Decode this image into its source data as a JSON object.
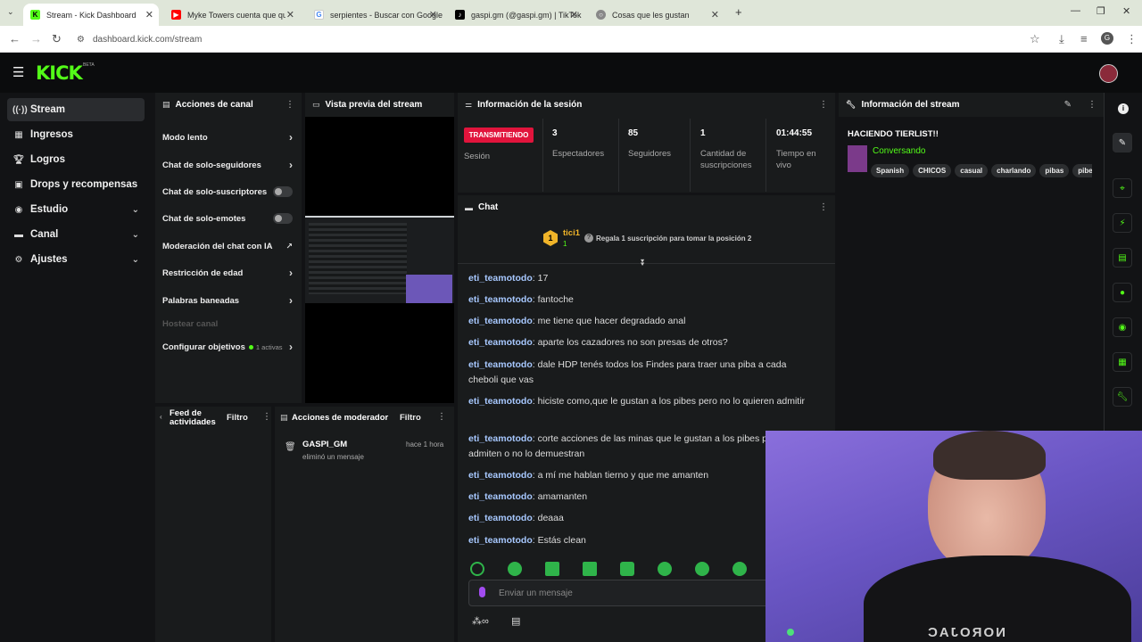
{
  "browser": {
    "tabs": [
      {
        "title": "Stream - Kick Dashboard",
        "icon": "kick-icon",
        "color": "#53fc18"
      },
      {
        "title": "Myke Towers cuenta que quería",
        "icon": "youtube-icon",
        "color": "#ff0000"
      },
      {
        "title": "serpientes - Buscar con Google",
        "icon": "google-icon",
        "color": "#4285f4"
      },
      {
        "title": "gaspi.gm (@gaspi.gm) | TikTok",
        "icon": "tiktok-icon",
        "color": "#000000"
      },
      {
        "title": "Cosas que les gustan",
        "icon": "globe-icon",
        "color": "#666666"
      }
    ],
    "url": "dashboard.kick.com/stream"
  },
  "kick": {
    "logo": "KICK",
    "beta": "BETA",
    "accent": "#53fc18"
  },
  "sidebar": {
    "items": [
      {
        "label": "Stream",
        "icon": "stream-icon"
      },
      {
        "label": "Ingresos",
        "icon": "income-icon"
      },
      {
        "label": "Logros",
        "icon": "trophy-icon"
      },
      {
        "label": "Drops y recompensas",
        "icon": "gift-icon"
      },
      {
        "label": "Estudio",
        "icon": "studio-icon"
      },
      {
        "label": "Canal",
        "icon": "channel-icon"
      },
      {
        "label": "Ajustes",
        "icon": "settings-icon"
      }
    ]
  },
  "channel_actions": {
    "title": "Acciones de canal",
    "items": [
      "Modo lento",
      "Chat de solo-seguidores",
      "Chat de solo-suscriptores",
      "Chat de solo-emotes",
      "Moderación del chat con IA",
      "Restricción de edad",
      "Palabras baneadas",
      "Hostear canal",
      "Configurar objetivos"
    ],
    "goals_badge": "1 activas"
  },
  "preview": {
    "title": "Vista previa del stream"
  },
  "session": {
    "title": "Información de la sesión",
    "live_badge": "TRANSMITIENDO",
    "session_label": "Sesión",
    "stats": [
      {
        "value": "3",
        "label": "Espectadores"
      },
      {
        "value": "85",
        "label": "Seguidores"
      },
      {
        "value": "1",
        "label": "Cantidad de suscripciones"
      },
      {
        "value": "01:44:55",
        "label": "Tiempo en vivo"
      }
    ]
  },
  "stream_info": {
    "title": "Información del stream",
    "stream_title": "HACIENDO TIERLIST!!",
    "category": "Conversando",
    "tags": [
      "Spanish",
      "CHICOS",
      "casual",
      "charlando",
      "pibas",
      "pibe"
    ]
  },
  "chat": {
    "title": "Chat",
    "pinned_user": "tici1",
    "pinned_count": "1",
    "gift_text": "Regala 1 suscripción para tomar la posición 2",
    "messages": [
      {
        "user": "eti_teamotodo",
        "text": "17"
      },
      {
        "user": "eti_teamotodo",
        "text": "fantoche"
      },
      {
        "user": "eti_teamotodo",
        "text": "me tiene que hacer degradado anal"
      },
      {
        "user": "eti_teamotodo",
        "text": "aparte los cazadores no son presas de otros?"
      },
      {
        "user": "eti_teamotodo",
        "text": "dale HDP tenés todos los Findes para traer una piba a cada cheboli que vas"
      },
      {
        "user": "eti_teamotodo",
        "text": "hiciste como,que le gustan a los pibes pero no lo quieren admitir"
      },
      {
        "user": "eti_teamotodo",
        "text": "corte acciones de las minas que le gustan a los pibes pero no lo admiten o no lo demuestran"
      },
      {
        "user": "eti_teamotodo",
        "text": "a mí me hablan tierno y que me amanten"
      },
      {
        "user": "eti_teamotodo",
        "text": "amamanten"
      },
      {
        "user": "eti_teamotodo",
        "text": "deaaa"
      },
      {
        "user": "eti_teamotodo",
        "text": "Estás clean"
      }
    ],
    "input_placeholder": "Enviar un mensaje"
  },
  "activity_feed": {
    "title": "Feed de actividades",
    "filter": "Filtro"
  },
  "mod_actions": {
    "title": "Acciones de moderador",
    "filter": "Filtro",
    "entries": [
      {
        "user": "GASPI_GM",
        "time": "hace 1 hora",
        "action": "eliminó un mensaje"
      }
    ]
  },
  "webcam_overlay": {
    "shirt_text": "NOROJAC"
  }
}
